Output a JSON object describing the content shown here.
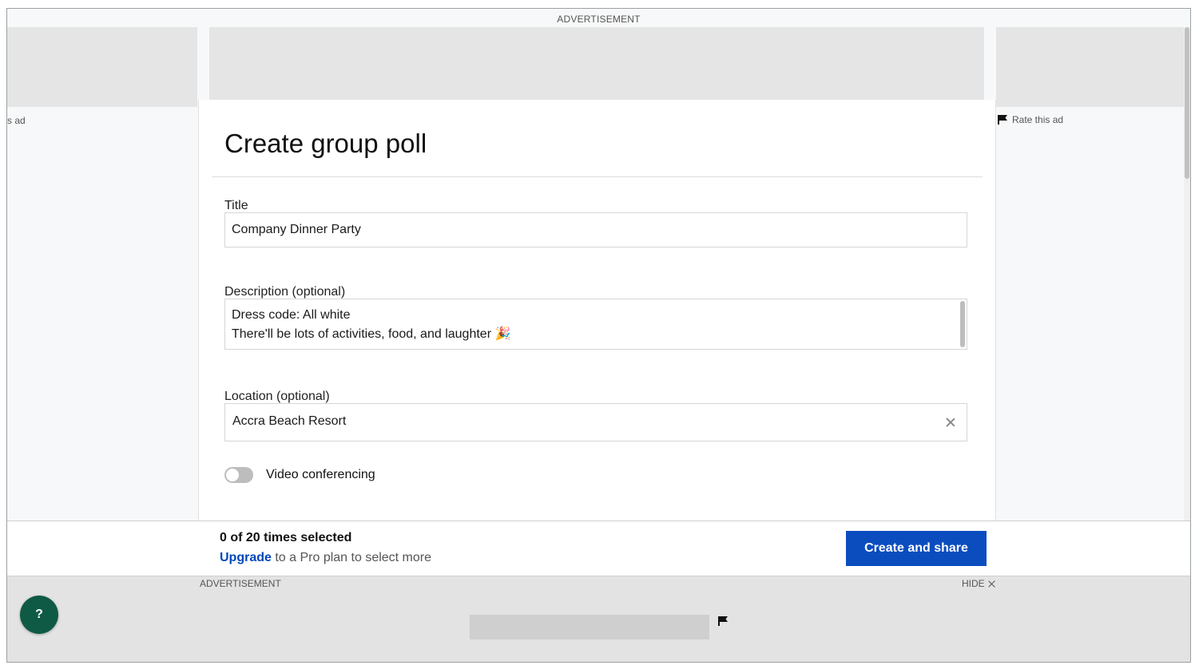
{
  "ads": {
    "top_label": "ADVERTISEMENT",
    "left_side_text": "s ad",
    "rate_ad": "Rate this ad",
    "bottom_label": "ADVERTISEMENT",
    "hide_label": "HIDE"
  },
  "modal": {
    "title": "Create group poll",
    "fields": {
      "title_label": "Title",
      "title_value": "Company Dinner Party",
      "description_label": "Description (optional)",
      "description_line1": "Dress code: All white",
      "description_line2": "There'll be lots of activities, food, and laughter 🎉",
      "location_label": "Location (optional)",
      "location_value": "Accra Beach Resort"
    },
    "video_conferencing": {
      "label": "Video conferencing",
      "enabled": false
    }
  },
  "footer": {
    "times_selected": "0 of 20 times selected",
    "upgrade_link": "Upgrade",
    "upgrade_text": " to a Pro plan to select more",
    "create_button": "Create and share"
  },
  "help": {
    "label": "?"
  },
  "colors": {
    "primary_button": "#0b4dbf",
    "link": "#0047bb",
    "help_button": "#0f5a45"
  }
}
